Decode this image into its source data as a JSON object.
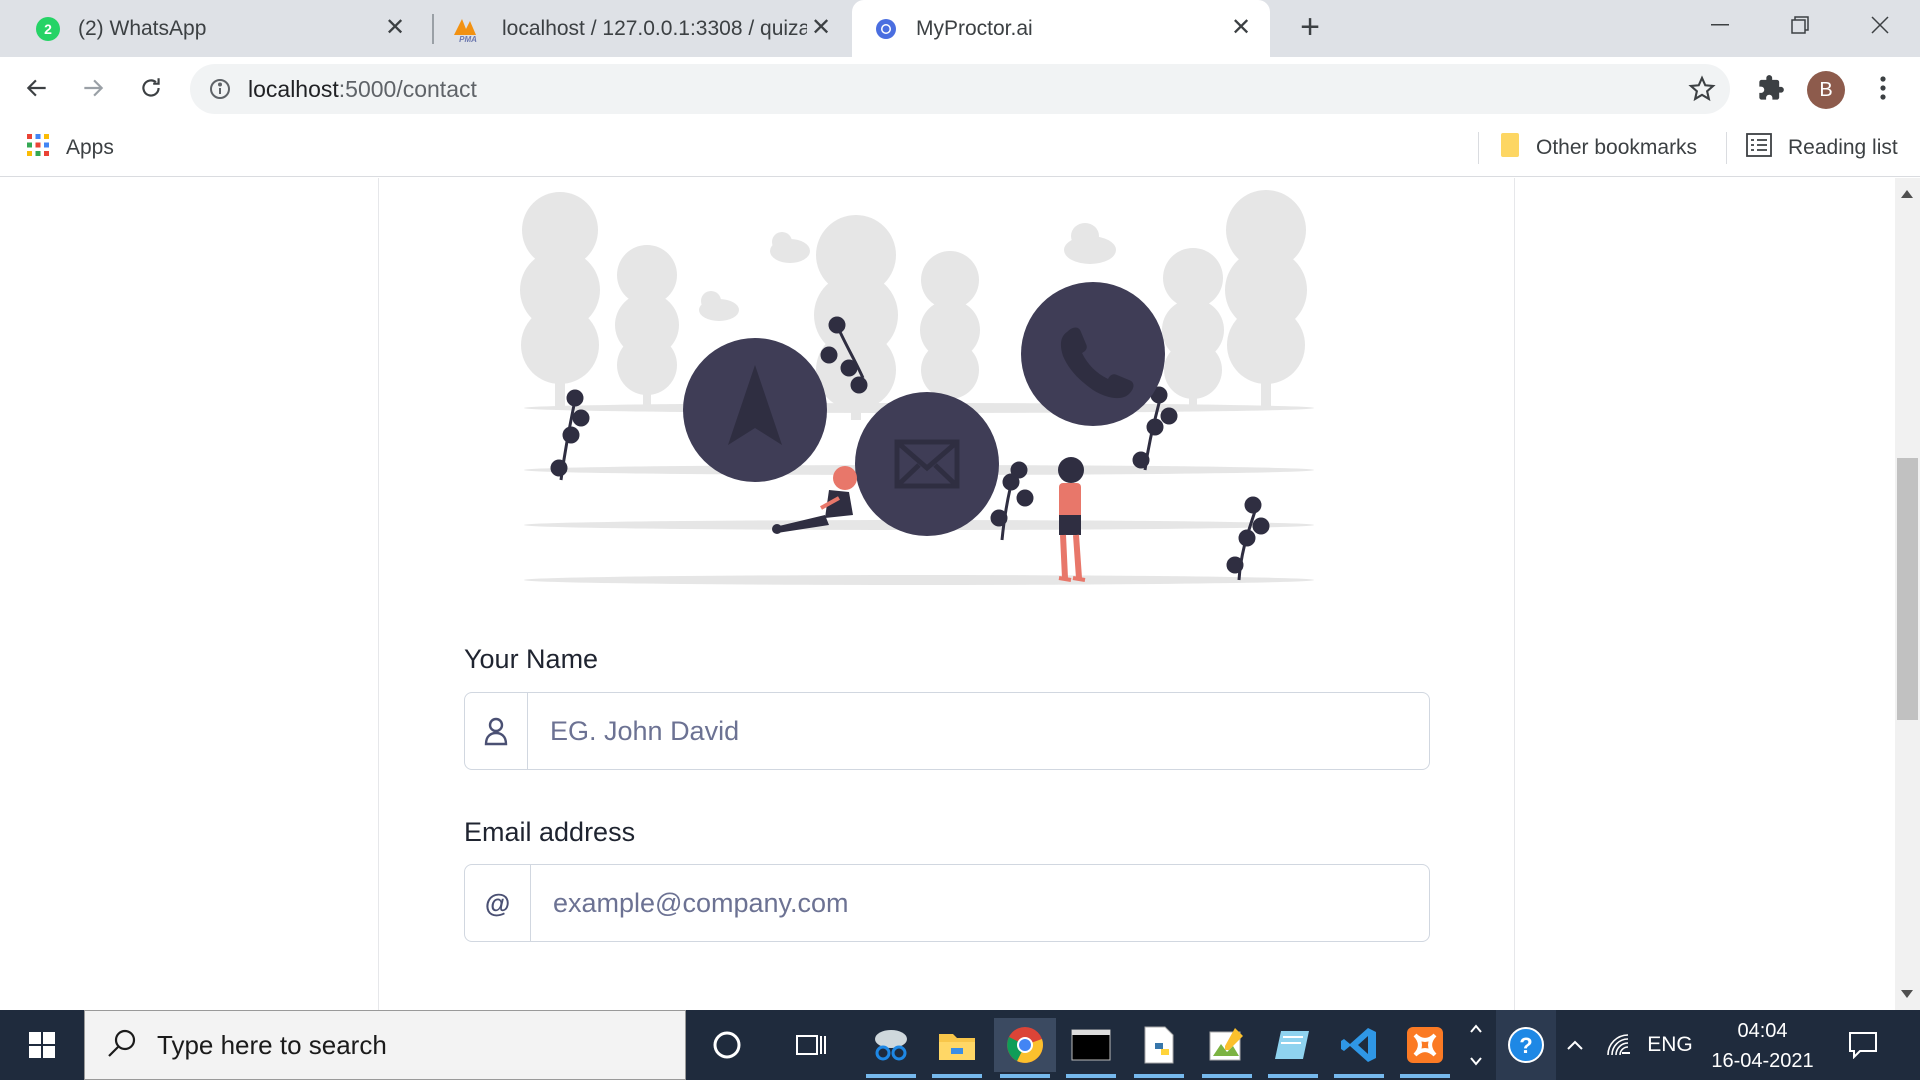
{
  "browser": {
    "tabs": [
      {
        "title": "(2) WhatsApp",
        "badge": "2"
      },
      {
        "title": "localhost / 127.0.0.1:3308 / quiza",
        "favicon_label": "PMA"
      },
      {
        "title": "MyProctor.ai"
      }
    ],
    "address": {
      "host": "localhost",
      "path": ":5000/contact"
    },
    "profile_initial": "B",
    "bookmarks": {
      "apps": "Apps",
      "other": "Other bookmarks",
      "reading": "Reading list"
    }
  },
  "page": {
    "form": {
      "name_label": "Your Name",
      "name_placeholder": "EG. John David",
      "email_label": "Email address",
      "email_addon": "@",
      "email_placeholder": "example@company.com"
    }
  },
  "taskbar": {
    "search_placeholder": "Type here to search",
    "language": "ENG",
    "time": "04:04",
    "date": "16-04-2021"
  },
  "colors": {
    "accent_dark": "#3f3d56",
    "person_skin": "#e8776a",
    "tree_gray": "#e6e6e6",
    "taskbar": "#1f2b3d"
  }
}
